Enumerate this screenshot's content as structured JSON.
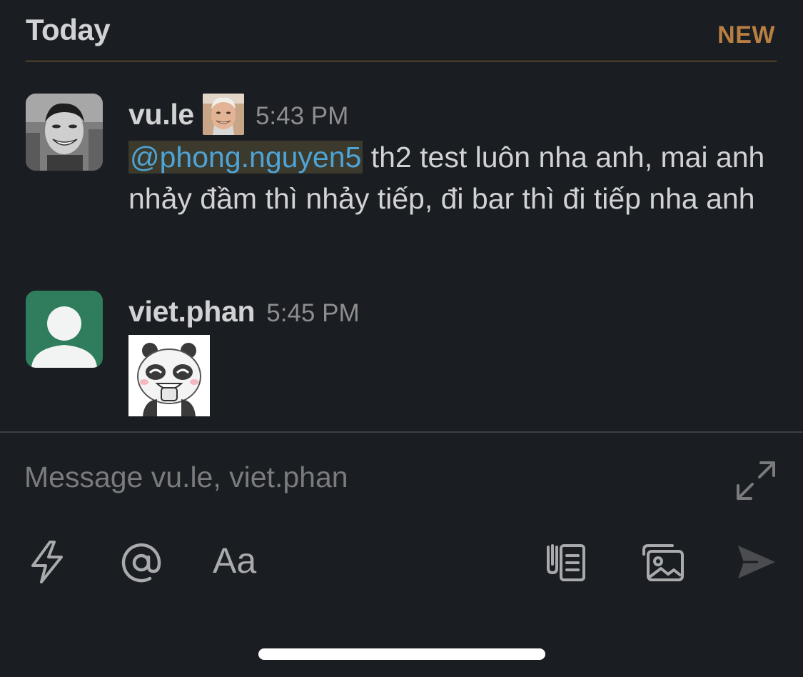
{
  "day_header": {
    "title": "Today",
    "new_label": "NEW"
  },
  "messages": [
    {
      "sender": "vu.le",
      "time": "5:43 PM",
      "has_status_emoji": true,
      "mention": "@phong.nguyen5",
      "text": " th2 test luôn nha anh, mai anh nhảy đầm thì nhảy tiếp, đi bar thì đi tiếp nha anh"
    },
    {
      "sender": "viet.phan",
      "time": "5:45 PM",
      "attachment": "panda-sticker"
    }
  ],
  "composer": {
    "placeholder": "Message vu.le, viet.phan",
    "value": "",
    "format_label": "Aa"
  },
  "icons": {
    "expand": "expand-icon",
    "shortcuts": "lightning-icon",
    "mention": "at-icon",
    "format": "text-format-icon",
    "attach": "attachment-icon",
    "image": "image-icon",
    "send": "send-icon"
  },
  "colors": {
    "background": "#1a1d21",
    "new_accent": "#b77f43",
    "mention_text": "#4ea3d7",
    "mention_bg": "#3b3a2c",
    "generic_avatar_bg": "#2f7d5c"
  }
}
